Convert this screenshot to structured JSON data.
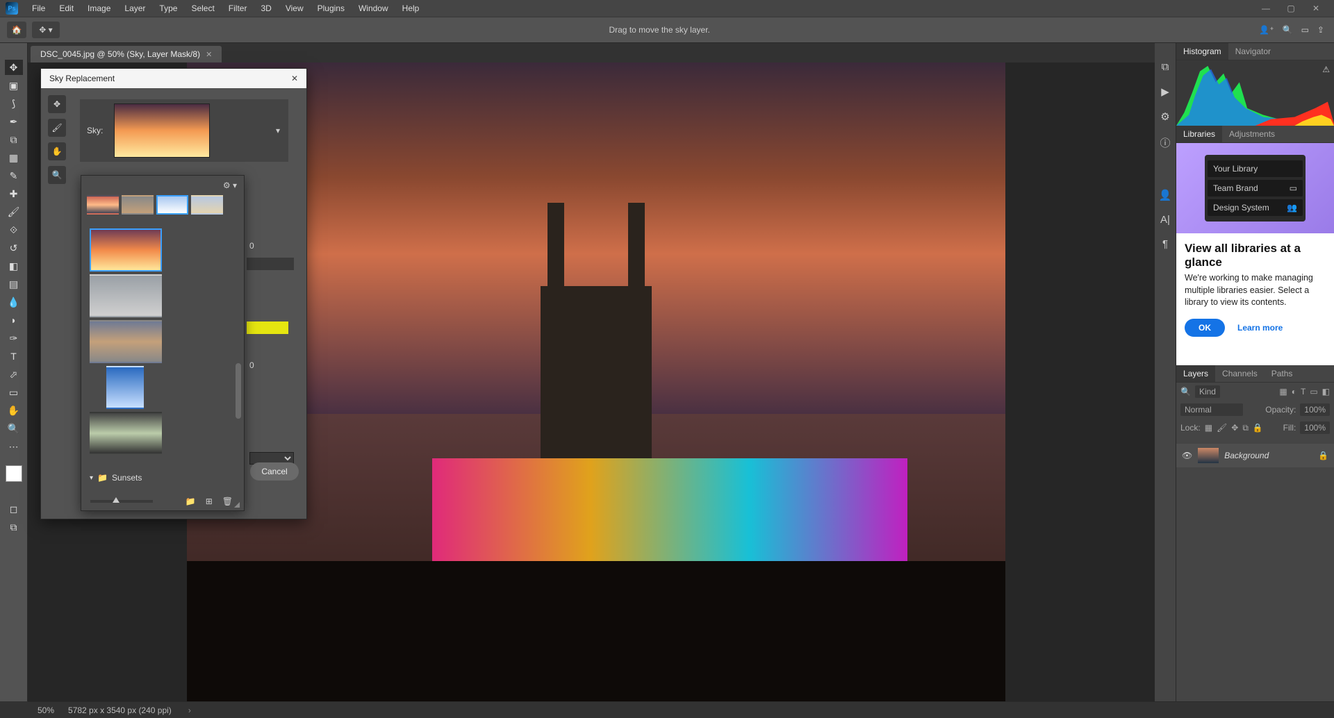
{
  "menu": {
    "items": [
      "File",
      "Edit",
      "Image",
      "Layer",
      "Type",
      "Select",
      "Filter",
      "3D",
      "View",
      "Plugins",
      "Window",
      "Help"
    ]
  },
  "optionbar": {
    "hint": "Drag to move the sky layer."
  },
  "tabs": {
    "doc": "DSC_0045.jpg @ 50% (Sky, Layer Mask/8)"
  },
  "tools": [
    "move",
    "marquee",
    "lasso",
    "wand",
    "crop",
    "frame",
    "eyedrop",
    "heal",
    "brush",
    "stamp",
    "history",
    "eraser",
    "gradient",
    "blur",
    "dodge",
    "pen",
    "text",
    "path",
    "rect",
    "hand",
    "zoom",
    "more"
  ],
  "status": {
    "zoom": "50%",
    "dims": "5782 px x 3540 px (240 ppi)"
  },
  "histogram": {
    "tabs": [
      "Histogram",
      "Navigator"
    ],
    "warn": "⚠"
  },
  "libraries": {
    "tabs": [
      "Libraries",
      "Adjustments"
    ],
    "card_rows": [
      "Your Library",
      "Team Brand",
      "Design System"
    ],
    "title": "View all libraries at a glance",
    "body": "We're working to make managing multiple libraries easier. Select a library to view its contents.",
    "ok": "OK",
    "learn": "Learn more"
  },
  "layers": {
    "tabs": [
      "Layers",
      "Channels",
      "Paths"
    ],
    "kind": "Kind",
    "blend": "Normal",
    "opacity_label": "Opacity:",
    "opacity_val": "100%",
    "lock_label": "Lock:",
    "fill_label": "Fill:",
    "fill_val": "100%",
    "row_name": "Background"
  },
  "dialog": {
    "title": "Sky Replacement",
    "sky_label": "Sky:",
    "val0": "0",
    "val1": "0",
    "valy": "",
    "cancel": "Cancel",
    "folder": "Sunsets"
  }
}
